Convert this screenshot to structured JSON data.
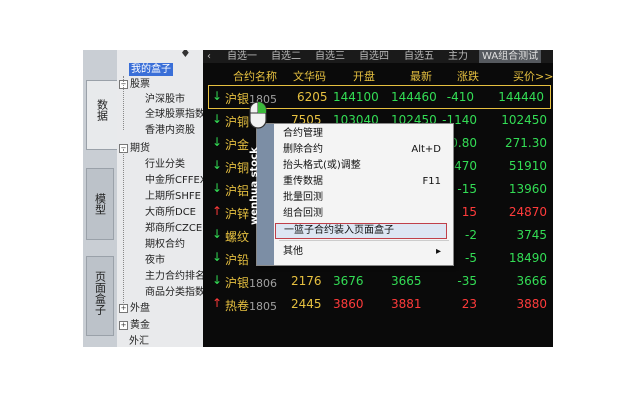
{
  "left_tabs": [
    {
      "label": "数据",
      "active": true
    },
    {
      "label": "模型",
      "active": false
    },
    {
      "label": "页面盒子",
      "active": false
    }
  ],
  "tree": {
    "pin": "♦",
    "items": [
      {
        "label": "我的盒子",
        "selected": true
      },
      {
        "label": "股票",
        "expand": "−"
      },
      {
        "label": "沪深股市"
      },
      {
        "label": "全球股票指数"
      },
      {
        "label": "香港内资股"
      },
      {
        "label": "期货",
        "expand": "−"
      },
      {
        "label": "行业分类"
      },
      {
        "label": "中金所CFFEX"
      },
      {
        "label": "上期所SHFE"
      },
      {
        "label": "大商所DCE"
      },
      {
        "label": "郑商所CZCE"
      },
      {
        "label": "期权合约"
      },
      {
        "label": "夜市"
      },
      {
        "label": "主力合约排名"
      },
      {
        "label": "商品分类指数"
      },
      {
        "label": "外盘",
        "expand": "+"
      },
      {
        "label": "黄金",
        "expand": "+"
      },
      {
        "label": "外汇"
      }
    ]
  },
  "top_tabs": {
    "left_arrow": "‹",
    "items": [
      "自选一",
      "自选二",
      "自选三",
      "自选四",
      "自选五",
      "主力",
      "WA组合测试"
    ],
    "active_index": 6
  },
  "columns": {
    "name": "合约名称",
    "wenhua": "文华码",
    "open": "开盘",
    "last": "最新",
    "change": "涨跌",
    "buy": "买价>>"
  },
  "rows": [
    {
      "dir": "down",
      "name": "沪银",
      "code": "1805",
      "wh": "6205",
      "open": "144100",
      "last": "144460",
      "chg": "-410",
      "buy": "144440",
      "open_c": "green",
      "last_c": "green",
      "chg_c": "green",
      "buy_c": "green"
    },
    {
      "dir": "down",
      "name": "沪铜",
      "code": "",
      "wh": "7505",
      "open": "103040",
      "last": "102450",
      "chg": "-1140",
      "buy": "102450",
      "open_c": "green",
      "last_c": "green",
      "chg_c": "green",
      "buy_c": "green"
    },
    {
      "dir": "down",
      "name": "沪金",
      "code": "",
      "wh": "",
      "open": "",
      "last": "",
      "chg": "-0.80",
      "buy": "271.30",
      "open_c": "green",
      "last_c": "green",
      "chg_c": "green",
      "buy_c": "green"
    },
    {
      "dir": "down",
      "name": "沪铜",
      "code": "",
      "wh": "",
      "open": "",
      "last": "",
      "chg": "-470",
      "buy": "51910",
      "open_c": "green",
      "last_c": "green",
      "chg_c": "green",
      "buy_c": "green"
    },
    {
      "dir": "down",
      "name": "沪铝",
      "code": "",
      "wh": "",
      "open": "",
      "last": "",
      "chg": "-15",
      "buy": "13960",
      "open_c": "green",
      "last_c": "green",
      "chg_c": "green",
      "buy_c": "green"
    },
    {
      "dir": "up",
      "name": "沪锌",
      "code": "",
      "wh": "",
      "open": "",
      "last": "",
      "chg": "15",
      "buy": "24870",
      "open_c": "red",
      "last_c": "red",
      "chg_c": "red",
      "buy_c": "red"
    },
    {
      "dir": "down",
      "name": "螺纹",
      "code": "",
      "wh": "",
      "open": "",
      "last": "",
      "chg": "-2",
      "buy": "3745",
      "open_c": "green",
      "last_c": "green",
      "chg_c": "green",
      "buy_c": "green"
    },
    {
      "dir": "down",
      "name": "沪铅",
      "code": "",
      "wh": "",
      "open": "",
      "last": "",
      "chg": "-5",
      "buy": "18490",
      "open_c": "green",
      "last_c": "green",
      "chg_c": "green",
      "buy_c": "green"
    },
    {
      "dir": "down",
      "name": "沪银",
      "code": "1806",
      "wh": "2176",
      "open": "3676",
      "last": "3665",
      "chg": "-35",
      "buy": "3666",
      "open_c": "green",
      "last_c": "green",
      "chg_c": "green",
      "buy_c": "green"
    },
    {
      "dir": "up",
      "name": "热卷",
      "code": "1805",
      "wh": "2445",
      "open": "3860",
      "last": "3881",
      "chg": "23",
      "buy": "3880",
      "open_c": "red",
      "last_c": "red",
      "chg_c": "red",
      "buy_c": "red"
    }
  ],
  "context_menu": {
    "side_label": "wenhua stock",
    "items": [
      {
        "label": "合约管理",
        "shortcut": ""
      },
      {
        "label": "删除合约",
        "shortcut": "Alt+D"
      },
      {
        "label": "抬头格式(或)调整",
        "shortcut": ""
      },
      {
        "label": "重传数据",
        "shortcut": "F11"
      },
      {
        "label": "批量回测",
        "shortcut": ""
      },
      {
        "label": "组合回测",
        "shortcut": ""
      },
      {
        "label": "一篮子合约装入页面盒子",
        "shortcut": "",
        "highlight": true
      },
      {
        "label": "其他",
        "shortcut": "▸"
      }
    ]
  },
  "colors": {
    "up": "#ff3b3b",
    "down": "#33dd55",
    "header": "#e6c040",
    "accent": "#c0404a"
  }
}
